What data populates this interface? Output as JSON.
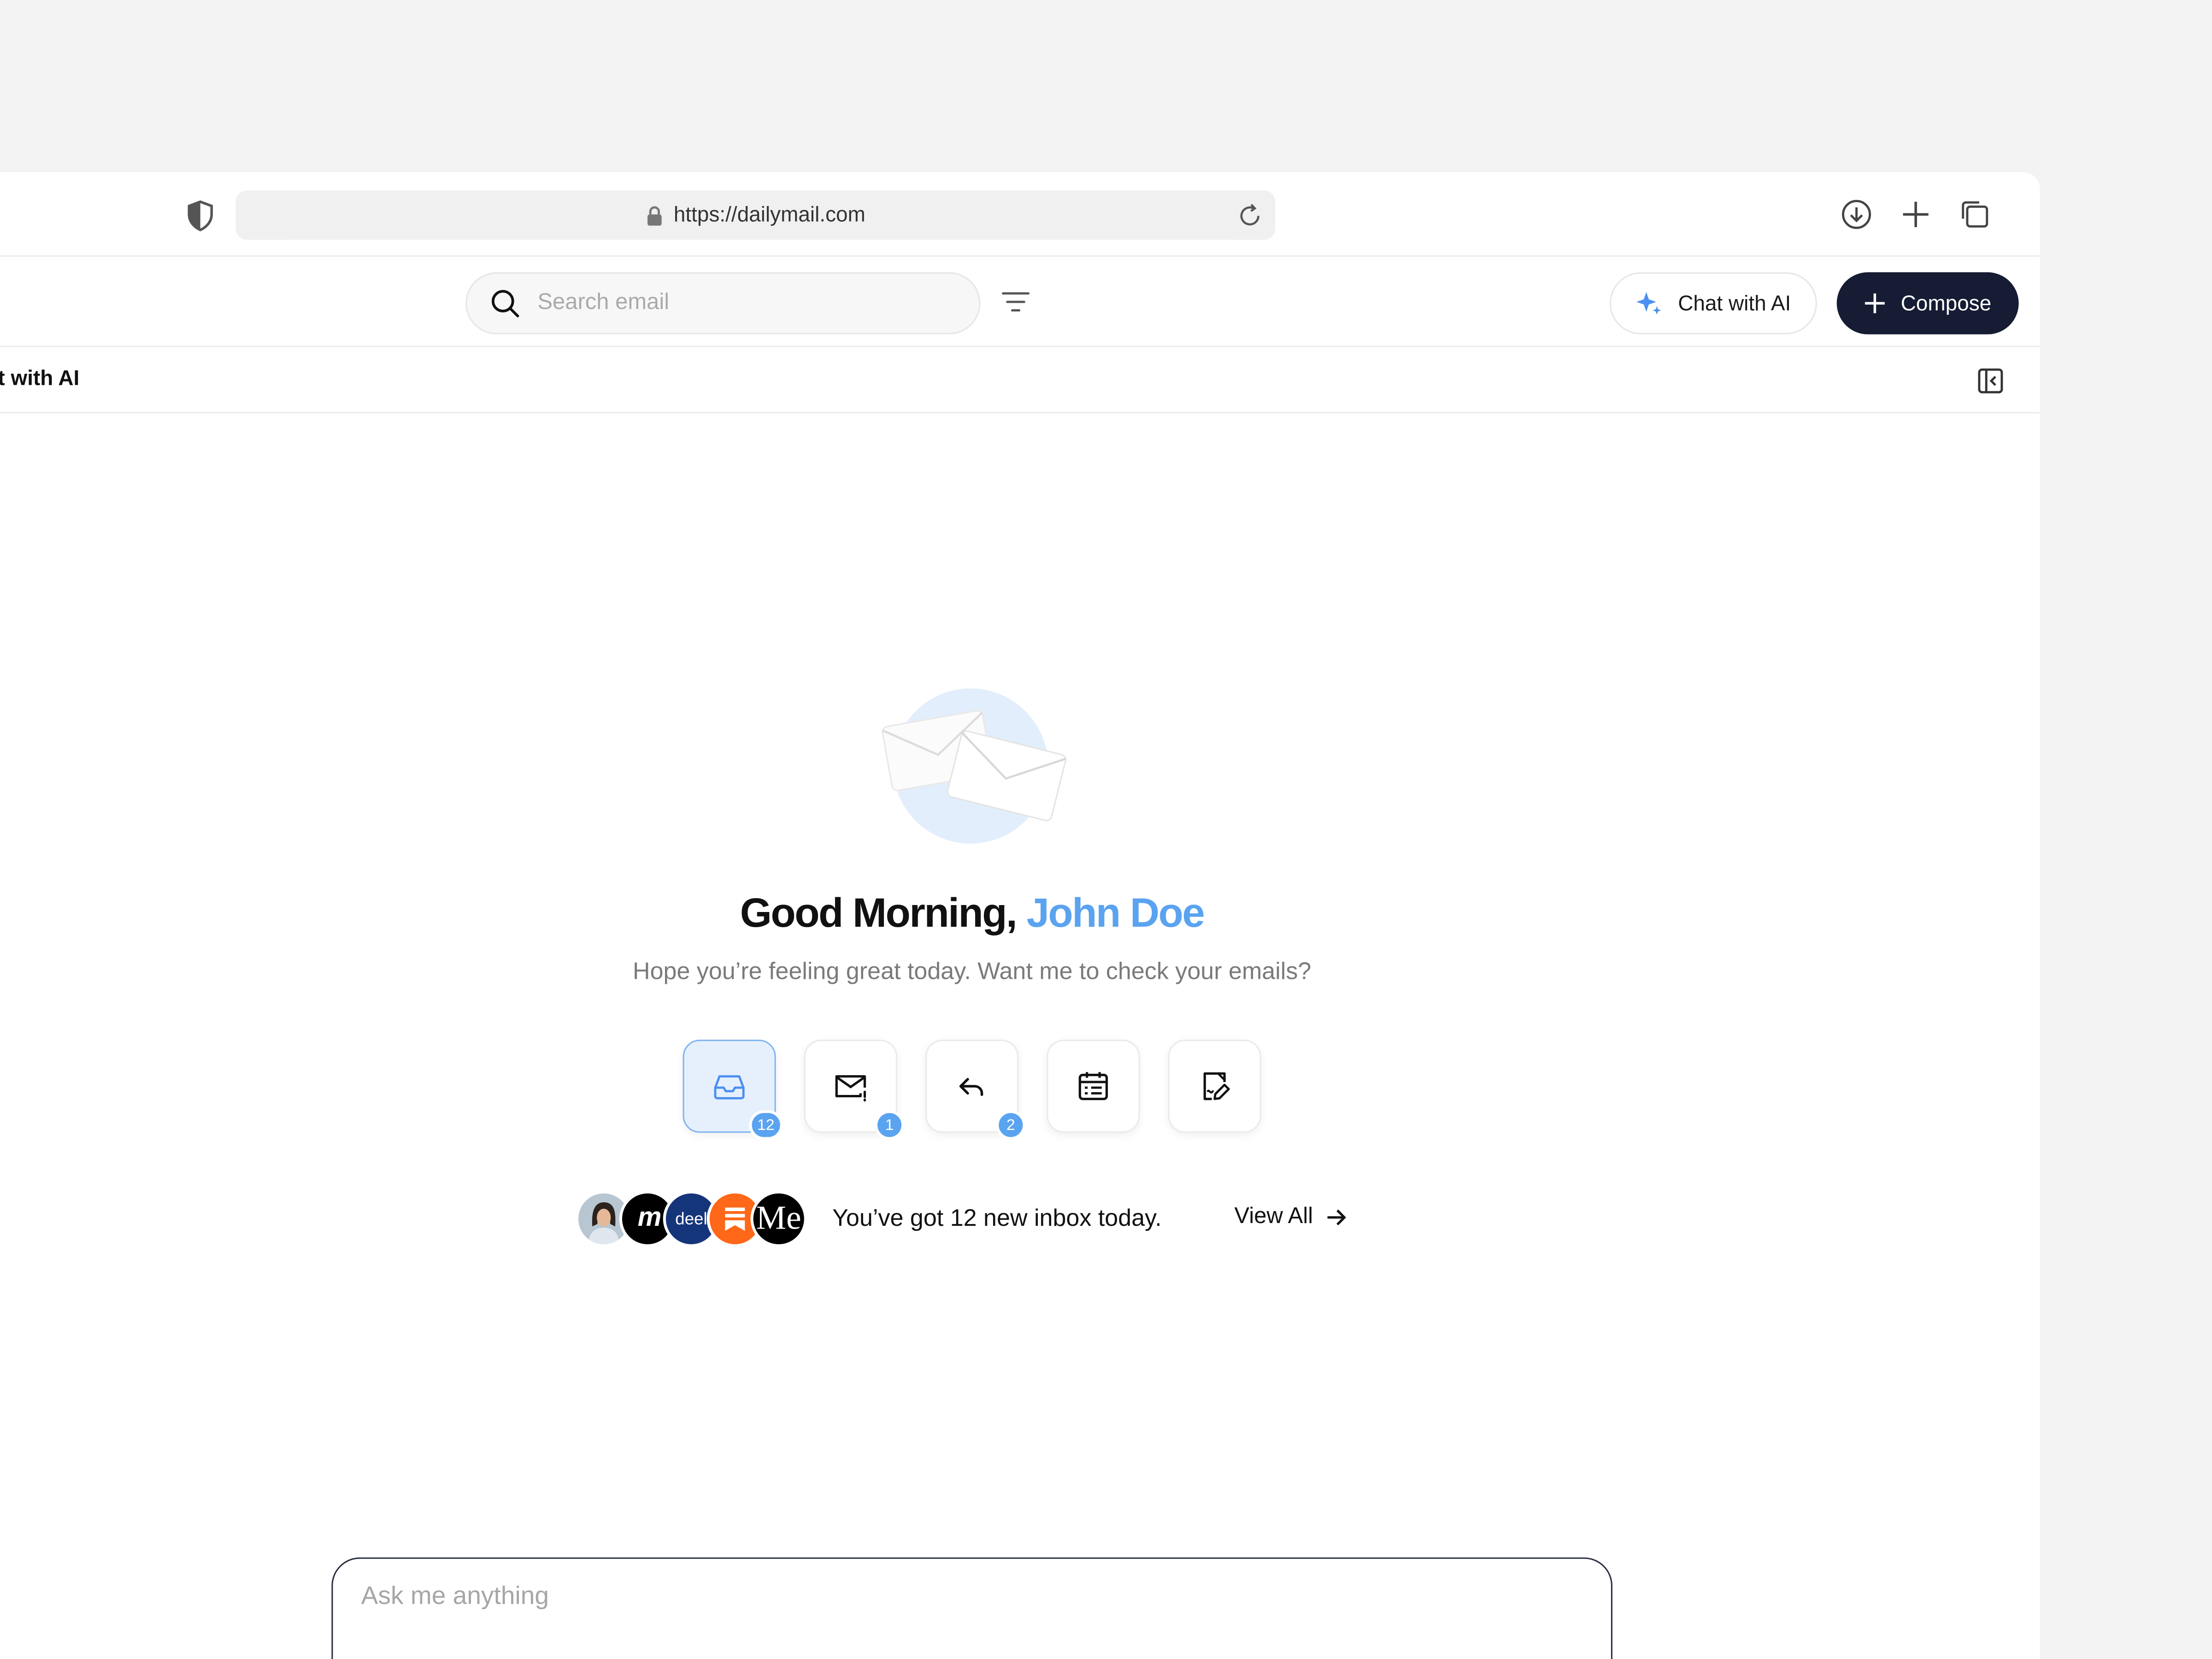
{
  "browser": {
    "url": "https://dailymail.com",
    "icons": [
      "shield-icon",
      "lock-icon",
      "reload-icon",
      "download-icon",
      "new-tab-icon",
      "tabs-icon"
    ]
  },
  "header": {
    "search_placeholder": "Search email",
    "chat_ai_label": "Chat with AI",
    "compose_label": "Compose"
  },
  "subheader": {
    "title": "hat with AI"
  },
  "main": {
    "greeting_prefix": "Good Morning,",
    "user_name": "John Doe",
    "subtext": "Hope you’re feeling great today. Want me to check your emails?",
    "tiles": [
      {
        "icon": "inbox-icon",
        "badge": "12",
        "active": true
      },
      {
        "icon": "mail-alert-icon",
        "badge": "1"
      },
      {
        "icon": "reply-icon",
        "badge": "2"
      },
      {
        "icon": "calendar-icon"
      },
      {
        "icon": "document-edit-icon"
      }
    ],
    "avatars": [
      "person-avatar",
      "m-logo",
      "deel",
      "substack-logo",
      "Me"
    ],
    "summary": "You’ve got 12 new inbox today.",
    "view_all": "View All"
  },
  "ask": {
    "placeholder": "Ask me anything"
  },
  "colors": {
    "accent": "#5aa3f0",
    "compose_bg": "#151c33",
    "background": "#f3f3f3"
  }
}
